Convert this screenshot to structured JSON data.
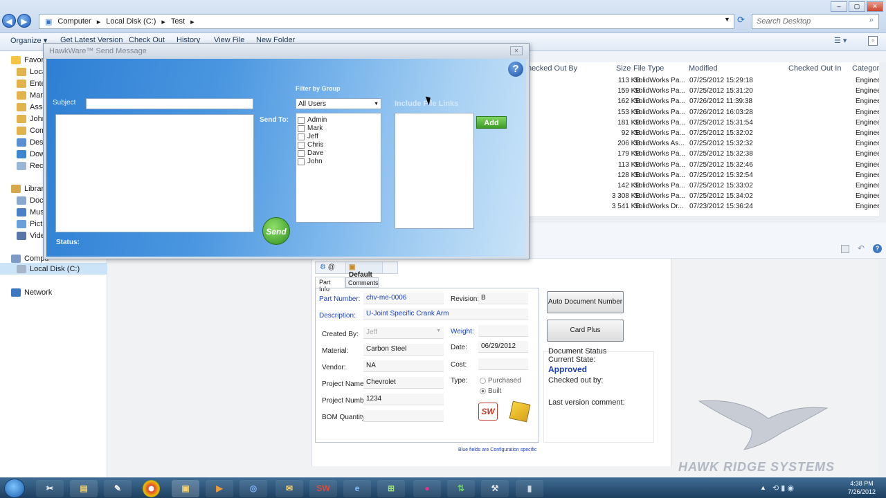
{
  "explorer": {
    "breadcrumb": [
      "Computer",
      "Local Disk (C:)",
      "Test"
    ],
    "search_placeholder": "Search Desktop",
    "toolbar": [
      "Organize ▾",
      "Get Latest Version",
      "Check Out",
      "History",
      "View File",
      "New Folder"
    ],
    "nav": {
      "favorites": [
        "Favori",
        "Loca",
        "Ente",
        "Mark",
        "Asse",
        "John",
        "Com",
        "Desk",
        "Dow",
        "Rece"
      ],
      "libraries_label": "Librari",
      "libraries": [
        "Docu",
        "Musi",
        "Pictu",
        "Vide"
      ],
      "computer_label": "Compu",
      "local_disk": "Local Disk (C:)",
      "network": "Network"
    },
    "columns": [
      "hecked Out By",
      "Size",
      "File Type",
      "Modified",
      "Checked Out In",
      "Category"
    ],
    "files": [
      {
        "size": "113 KB",
        "type": "SolidWorks Pa...",
        "modified": "07/25/2012 15:29:18",
        "category": "Engineering"
      },
      {
        "size": "159 KB",
        "type": "SolidWorks Pa...",
        "modified": "07/25/2012 15:31:20",
        "category": "Engineering"
      },
      {
        "size": "162 KB",
        "type": "SolidWorks Pa...",
        "modified": "07/26/2012 11:39:38",
        "category": "Engineering"
      },
      {
        "size": "153 KB",
        "type": "SolidWorks Pa...",
        "modified": "07/26/2012 16:03:28",
        "category": "Engineering"
      },
      {
        "size": "181 KB",
        "type": "SolidWorks Pa...",
        "modified": "07/25/2012 15:31:54",
        "category": "Engineering"
      },
      {
        "size": "92 KB",
        "type": "SolidWorks Pa...",
        "modified": "07/25/2012 15:32:02",
        "category": "Engineering"
      },
      {
        "size": "206 KB",
        "type": "SolidWorks As...",
        "modified": "07/25/2012 15:32:32",
        "category": "Engineering"
      },
      {
        "size": "179 KB",
        "type": "SolidWorks Pa...",
        "modified": "07/25/2012 15:32:38",
        "category": "Engineering"
      },
      {
        "size": "113 KB",
        "type": "SolidWorks Pa...",
        "modified": "07/25/2012 15:32:46",
        "category": "Engineering"
      },
      {
        "size": "128 KB",
        "type": "SolidWorks Pa...",
        "modified": "07/25/2012 15:32:54",
        "category": "Engineering"
      },
      {
        "size": "142 KB",
        "type": "SolidWorks Pa...",
        "modified": "07/25/2012 15:33:02",
        "category": "Engineering"
      },
      {
        "size": "3 308 KB",
        "type": "SolidWorks Pa...",
        "modified": "07/25/2012 15:34:02",
        "category": "Engineering"
      },
      {
        "size": "3 541 KB",
        "type": "SolidWorks Dr...",
        "modified": "07/23/2012 15:36:24",
        "category": "Engineering"
      }
    ]
  },
  "dialog": {
    "title": "HawkWare™ Send Message",
    "subject_label": "Subject",
    "sendto_label": "Send To:",
    "status_label": "Status:",
    "filter_label": "Filter by Group",
    "group_selected": "All Users",
    "include_label": "Include File Links",
    "users": [
      "Admin",
      "Mark",
      "Jeff",
      "Chris",
      "Dave",
      "John"
    ],
    "send_label": "Send",
    "add_label": "Add",
    "help_label": "?"
  },
  "part": {
    "config_tab": "Default",
    "config_prefix": "@",
    "tabs": [
      "Part Info",
      "Comments"
    ],
    "part_number_label": "Part Number:",
    "part_number": "chv-me-0006",
    "revision_label": "Revision:",
    "revision": "B",
    "description_label": "Description:",
    "description": "U-Joint Specific Crank Arm",
    "created_by_label": "Created By:",
    "created_by": "Jeff",
    "weight_label": "Weight:",
    "material_label": "Material:",
    "material": "Carbon Steel",
    "date_label": "Date:",
    "date": "06/29/2012",
    "vendor_label": "Vendor:",
    "vendor": "NA",
    "cost_label": "Cost:",
    "project_name_label": "Project Name:",
    "project_name": "Chevrolet",
    "type_label": "Type:",
    "type_purchased": "Purchased",
    "type_built": "Built",
    "project_number_label": "Project Number:",
    "project_number": "1234",
    "bom_label": "BOM Quantity:",
    "footnote": "Blue fields are Configuration specific",
    "auto_doc_btn": "Auto Document Number",
    "card_plus_btn": "Card Plus",
    "sw_icon": "SW",
    "doc_status_label": "Document Status",
    "current_state_label": "Current State:",
    "current_state": "Approved",
    "checked_out_label": "Checked out by:",
    "last_comment_label": "Last version comment:"
  },
  "taskbar": {
    "time": "4:38 PM",
    "date": "7/26/2012",
    "sw_label": "SW"
  },
  "watermark": "HAWK RIDGE SYSTEMS",
  "colors": {
    "approved": "#1a3fc4",
    "dialog_blue": "#4a96e0",
    "send_green": "#2f8f1d"
  }
}
